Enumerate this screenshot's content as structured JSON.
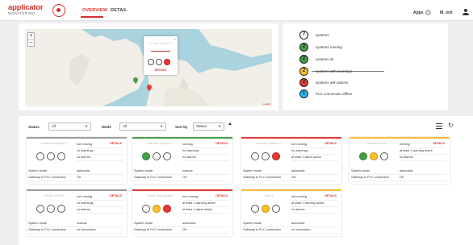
{
  "header": {
    "logo_text": "applicator",
    "logo_sub": "MONITORING",
    "tabs": [
      {
        "label": "OVERVIEW",
        "active": true
      },
      {
        "label": "DETAIL",
        "active": false
      }
    ],
    "apps_label": "Apps",
    "user_name": "M. ock"
  },
  "map": {
    "zoom_in": "+",
    "zoom_out": "−",
    "popup": {
      "system_name": "Acetyle system 3",
      "close": "×",
      "details_label": "DETAILS",
      "lights": [
        "off",
        "off",
        "red"
      ]
    },
    "attribution": "Leaflet"
  },
  "legend": [
    {
      "count": "7",
      "label": "systems",
      "color": "#ffffff"
    },
    {
      "count": "2",
      "label": "systems running",
      "color": "#43a047"
    },
    {
      "count": "2",
      "label": "systems ok",
      "color": "#43a047"
    },
    {
      "count": "2",
      "label": "systems with warnings",
      "color": "#fbc02d"
    },
    {
      "count": "2",
      "label": "systems with alarms",
      "color": "#e53935"
    },
    {
      "count": "1",
      "label": "PLC connection offline",
      "color": "#29b6f6"
    }
  ],
  "filters": {
    "status_label": "Status",
    "status_value": "All",
    "mode_label": "Mode",
    "mode_value": "All",
    "sort_label": "Sort by",
    "sort_value": "Status",
    "sort_direction": "ascending"
  },
  "cards_info_labels": {
    "system_mode": "System mode",
    "gateway": "Gateway to PLC connection",
    "details": "DETAILS"
  },
  "cards": [
    {
      "name": "Lobandia system 1",
      "border": "#9e9e9e",
      "lights": [
        "off",
        "off",
        "off"
      ],
      "status": [
        "not running",
        "no warnings",
        "no alarms"
      ],
      "mode": "automatic",
      "gateway": "OK"
    },
    {
      "name": "Nannfor system 1",
      "border": "#43a047",
      "lights": [
        "green",
        "off",
        "off"
      ],
      "status": [
        "running",
        "no warnings",
        "no alarms"
      ],
      "mode": "manual",
      "gateway": "OK"
    },
    {
      "name": "Nannfor system 2",
      "border": "#e53935",
      "lights": [
        "off",
        "off",
        "red"
      ],
      "status": [
        "not running",
        "no warnings",
        "at least 1 alarm active"
      ],
      "mode": "automatic",
      "gateway": "OK"
    },
    {
      "name": "Bkst Brothers",
      "border": "#fbc02d",
      "lights": [
        "green",
        "yellow",
        "off"
      ],
      "status": [
        "running",
        "at least 1 warning active",
        "no alarms"
      ],
      "mode": "automatic",
      "gateway": "OK"
    },
    {
      "name": "DEMO system",
      "border": "#9e9e9e",
      "lights": [
        "off",
        "off",
        "off"
      ],
      "status": [
        "not running",
        "no warnings",
        "no alarms"
      ],
      "mode": "manual",
      "gateway": "no connection"
    },
    {
      "name": "XANA Test system",
      "border": "#e53935",
      "lights": [
        "off",
        "yellow",
        "red"
      ],
      "status": [
        "not running",
        "at least 1 warning active",
        "at least 1 alarm active"
      ],
      "mode": "automatic",
      "gateway": "OK"
    },
    {
      "name": "Snat 1",
      "border": "#fbc02d",
      "lights": [
        "off",
        "yellow",
        "off"
      ],
      "status": [
        "not running",
        "at least 1 warning active",
        "no alarms"
      ],
      "mode": "automatic",
      "gateway": "no connection"
    }
  ]
}
